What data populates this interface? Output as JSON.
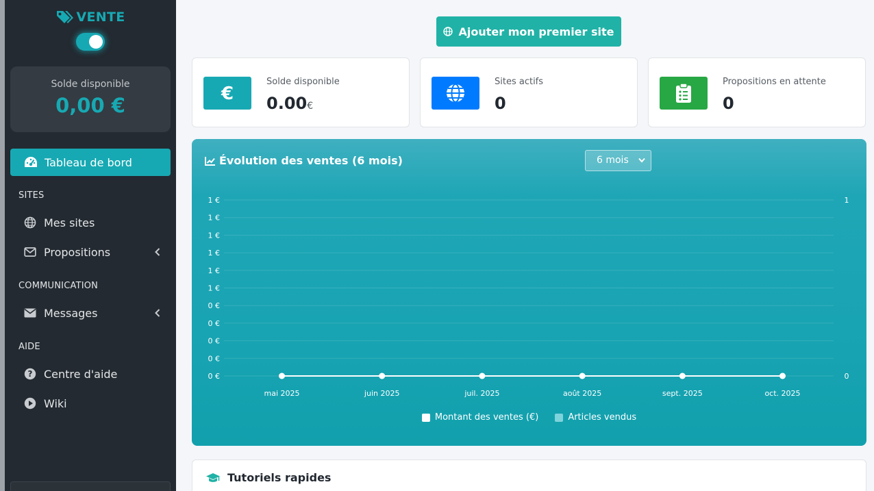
{
  "sidebar": {
    "brand": "VENTE",
    "balance_label": "Solde disponible",
    "balance_value": "0,00 €",
    "active_item": "Tableau de bord",
    "sections": {
      "sites": "SITES",
      "communication": "COMMUNICATION",
      "aide": "AIDE"
    },
    "items": {
      "mes_sites": "Mes sites",
      "propositions": "Propositions",
      "messages": "Messages",
      "centre_aide": "Centre d'aide",
      "wiki": "Wiki"
    }
  },
  "header": {
    "add_site_label": "Ajouter mon premier site"
  },
  "stats": [
    {
      "title": "Solde disponible",
      "value": "0.00",
      "unit": "€",
      "color": "#17a9b3",
      "icon": "euro-icon"
    },
    {
      "title": "Sites actifs",
      "value": "0",
      "color": "#007bff",
      "icon": "globe-icon"
    },
    {
      "title": "Propositions en attente",
      "value": "0",
      "color": "#28a745",
      "icon": "clipboard-list-icon"
    }
  ],
  "chart": {
    "title": "Évolution des ventes (6 mois)",
    "period_selected": "6 mois"
  },
  "chart_data": {
    "type": "line",
    "title": "Évolution des ventes (6 mois)",
    "categories": [
      "mai 2025",
      "juin 2025",
      "juil. 2025",
      "août 2025",
      "sept. 2025",
      "oct. 2025"
    ],
    "series": [
      {
        "name": "Montant des ventes (€)",
        "values": [
          0,
          0,
          0,
          0,
          0,
          0
        ],
        "color": "#ffffff"
      },
      {
        "name": "Articles vendus",
        "values": [
          0,
          0,
          0,
          0,
          0,
          0
        ],
        "color": "#7fd3db"
      }
    ],
    "y_left_ticks": [
      "1 €",
      "1 €",
      "1 €",
      "1 €",
      "1 €",
      "1 €",
      "0 €",
      "0 €",
      "0 €",
      "0 €",
      "0 €"
    ],
    "y_right_ticks": [
      "1",
      "0"
    ],
    "ylim": [
      0,
      1
    ],
    "grid": true,
    "legend": "bottom"
  },
  "tutorials": {
    "title": "Tutoriels rapides"
  }
}
